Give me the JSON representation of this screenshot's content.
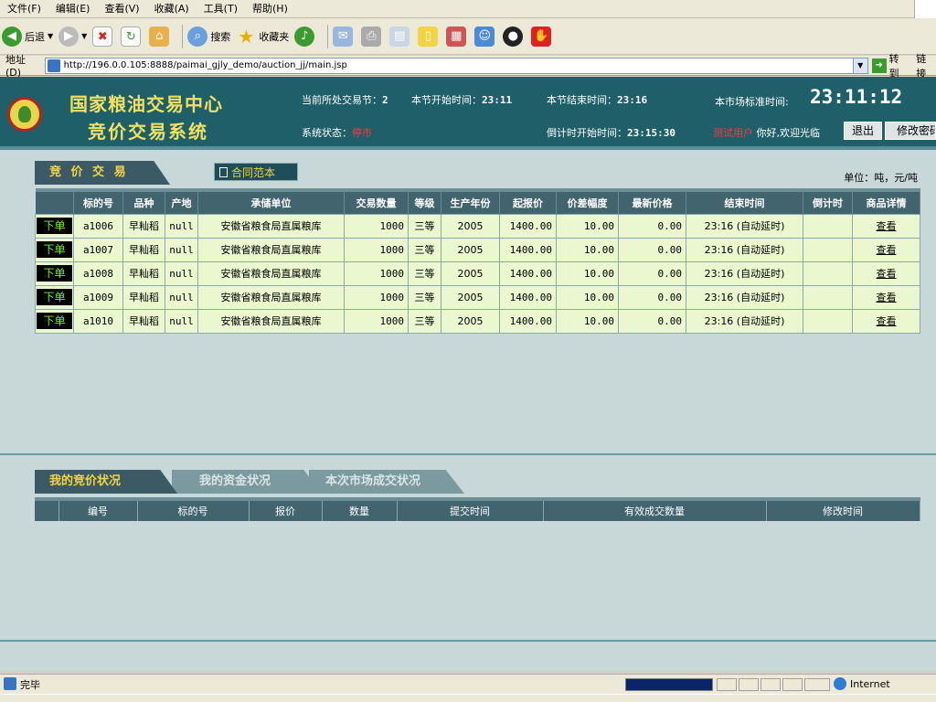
{
  "browser": {
    "menu": [
      "文件(F)",
      "编辑(E)",
      "查看(V)",
      "收藏(A)",
      "工具(T)",
      "帮助(H)"
    ],
    "toolbar": {
      "back": "后退",
      "search": "搜索",
      "favorites": "收藏夹"
    },
    "address_label": "地址(D)",
    "url": "http://196.0.0.105:8888/paimai_gjly_demo/auction_jj/main.jsp",
    "go": "转到",
    "links": "链接",
    "status": "完毕",
    "zone": "Internet",
    "progress": 1.0
  },
  "header": {
    "title1": "国家粮油交易中心",
    "title2": "竞价交易系统",
    "session_label": "当前所处交易节：",
    "session_value": "2",
    "start_label": "本节开始时间：",
    "start_value": "23:11",
    "end_label": "本节结束时间：",
    "end_value": "23:16",
    "clock_label": "本市场标准时间:",
    "clock_value": "23:11:12",
    "state_label": "系统状态：",
    "state_value": "停市",
    "countdown_label": "倒计时开始时间：",
    "countdown_value": "23:15:30",
    "user_name": "测试用户",
    "greeting": "你好,欢迎光临",
    "logout": "退出",
    "change_pwd": "修改密码"
  },
  "bidding": {
    "tab": "竞 价 交 易",
    "contract_btn": "合同范本",
    "unit": "单位：吨，元/吨",
    "columns": [
      "",
      "标的号",
      "品种",
      "产地",
      "承储单位",
      "交易数量",
      "等级",
      "生产年份",
      "起报价",
      "价差幅度",
      "最新价格",
      "结束时间",
      "倒计时",
      "商品详情"
    ],
    "order_label": "下单",
    "view_label": "查看",
    "rows": [
      {
        "id": "a1006",
        "variety": "早籼稻",
        "origin": "null",
        "unit": "安徽省粮食局直属粮库",
        "qty": "1000",
        "grade": "三等",
        "year": "2005",
        "start": "1400.00",
        "step": "10.00",
        "latest": "0.00",
        "end": "23:16 (自动延时)",
        "countdown": ""
      },
      {
        "id": "a1007",
        "variety": "早籼稻",
        "origin": "null",
        "unit": "安徽省粮食局直属粮库",
        "qty": "1000",
        "grade": "三等",
        "year": "2005",
        "start": "1400.00",
        "step": "10.00",
        "latest": "0.00",
        "end": "23:16 (自动延时)",
        "countdown": ""
      },
      {
        "id": "a1008",
        "variety": "早籼稻",
        "origin": "null",
        "unit": "安徽省粮食局直属粮库",
        "qty": "1000",
        "grade": "三等",
        "year": "2005",
        "start": "1400.00",
        "step": "10.00",
        "latest": "0.00",
        "end": "23:16 (自动延时)",
        "countdown": ""
      },
      {
        "id": "a1009",
        "variety": "早籼稻",
        "origin": "null",
        "unit": "安徽省粮食局直属粮库",
        "qty": "1000",
        "grade": "三等",
        "year": "2005",
        "start": "1400.00",
        "step": "10.00",
        "latest": "0.00",
        "end": "23:16 (自动延时)",
        "countdown": ""
      },
      {
        "id": "a1010",
        "variety": "早籼稻",
        "origin": "null",
        "unit": "安徽省粮食局直属粮库",
        "qty": "1000",
        "grade": "三等",
        "year": "2005",
        "start": "1400.00",
        "step": "10.00",
        "latest": "0.00",
        "end": "23:16 (自动延时)",
        "countdown": ""
      }
    ]
  },
  "status_panel": {
    "tabs": [
      "我的竞价状况",
      "我的资金状况",
      "本次市场成交状况"
    ],
    "columns": [
      "",
      "编号",
      "标的号",
      "报价",
      "数量",
      "提交时间",
      "有效成交数量",
      "修改时间"
    ]
  }
}
